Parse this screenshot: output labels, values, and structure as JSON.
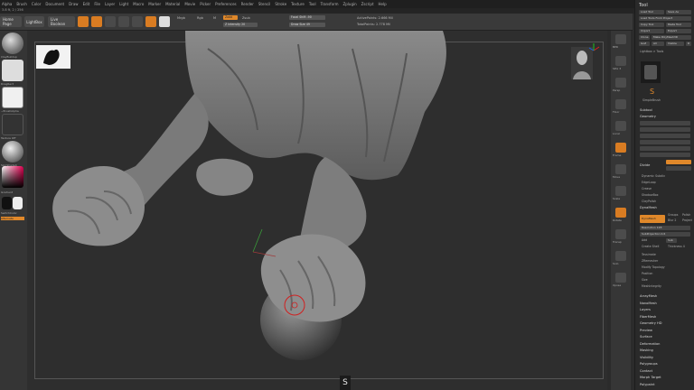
{
  "menubar": {
    "items": [
      "Alpha",
      "Brush",
      "Color",
      "Document",
      "Draw",
      "Edit",
      "File",
      "Layer",
      "Light",
      "Macro",
      "Marker",
      "Material",
      "Movie",
      "Picker",
      "Preferences",
      "Render",
      "Stencil",
      "Stroke",
      "Texture",
      "Tool",
      "Transform",
      "Zplugin",
      "Zscript",
      "Help"
    ]
  },
  "status": {
    "text": "3.8 ft, 2 / 256"
  },
  "toolbar": {
    "home_label": "Home Page",
    "lightbox_label": "LightBox",
    "live_boolean_label": "Live Boolean",
    "mrgb": "Mrgb",
    "rgb": "Rgb",
    "m": "M",
    "zadd": "Zadd",
    "zsub": "Zsub",
    "z_intensity": "Z Intensity 20",
    "focal_shift": "Focal Shift -90",
    "draw_size": "Draw Size 49",
    "active_points": "ActivePoints: 2.666 Mil",
    "total_points": "TotalPoints: 2.778 Mil"
  },
  "leftshelf": {
    "labels": [
      "ClayBuildup",
      "DragRect",
      "~BrushAlpha",
      "Texture Off",
      "SkinShade4",
      "Gradient",
      "SwitchColor",
      "Alternate"
    ]
  },
  "rightshelf": {
    "labels": [
      "BPR",
      "SPix 3",
      "Persp",
      "Floor",
      "Local",
      "Frame",
      "Move",
      "Scale",
      "Rotate",
      "Transp",
      "Solo",
      "Xpose"
    ]
  },
  "badge": {
    "letter": "S"
  },
  "panel": {
    "title": "Tool",
    "buttons": [
      "Load Tool",
      "Save As",
      "Load Tools From Project",
      "Copy Tool",
      "Paste Tool",
      "Import",
      "Export",
      "Clone",
      "Make PolyMesh3D",
      "GoZ",
      "All",
      "Visible",
      "R"
    ],
    "lightbox_tools": "Lightbox > Tools",
    "tool_name": "SimpleBrush",
    "sections": [
      "Subtool",
      "Geometry",
      "Divide",
      "Dynamic Subdiv",
      "EdgeLoop",
      "Crease",
      "ShadowBox",
      "ClayPolish",
      "DynaMesh"
    ],
    "dynamesh": [
      "DynaMesh",
      "Groups",
      "Polish",
      "Blur 2",
      "Project",
      "Resolution 128",
      "SubProjection 0.6",
      "Add",
      "Sub",
      "Create Shell",
      "Thickness 4"
    ],
    "subs": [
      "Tessimate",
      "ZRemesher",
      "Modify Topology",
      "Position",
      "Size",
      "MeshIntegrity"
    ],
    "lower": [
      "ArrayMesh",
      "NanoMesh",
      "Layers",
      "FiberMesh",
      "Geometry HD",
      "Preview",
      "Surface",
      "Deformation",
      "Masking",
      "Visibility",
      "Polygroups",
      "Contact",
      "Morph Target",
      "Polypaint"
    ]
  }
}
